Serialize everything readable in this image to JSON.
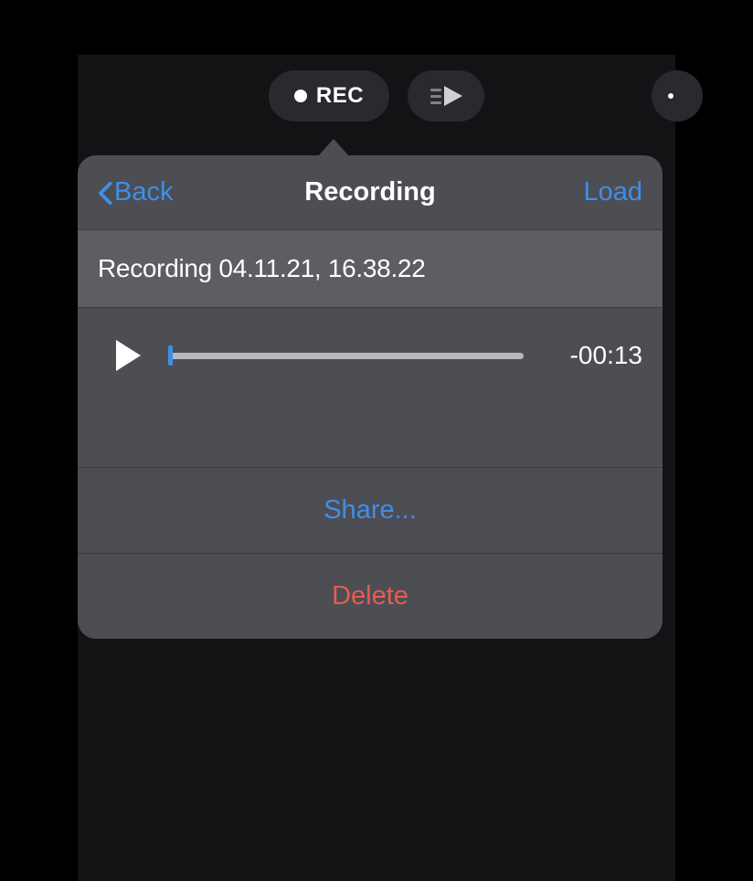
{
  "toolbar": {
    "rec_label": "REC"
  },
  "popover": {
    "back_label": "Back",
    "title": "Recording",
    "load_label": "Load",
    "filename": "Recording 04.11.21, 16.38.22",
    "time_remaining": "-00:13",
    "share_label": "Share...",
    "delete_label": "Delete"
  }
}
